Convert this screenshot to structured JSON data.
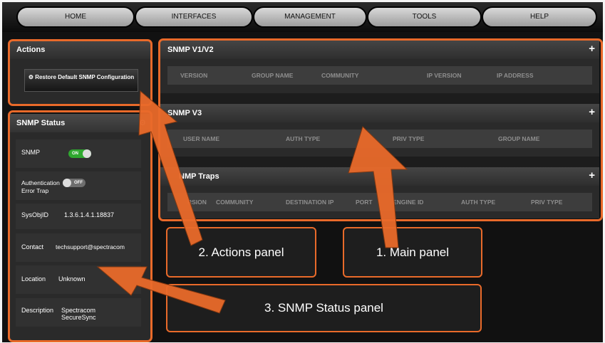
{
  "nav": [
    "HOME",
    "INTERFACES",
    "MANAGEMENT",
    "TOOLS",
    "HELP"
  ],
  "actions": {
    "title": "Actions",
    "button_icon": "gear-icon",
    "button_label": "⚙ Restore Default SNMP Configuration"
  },
  "snmp_v1v2": {
    "title": "SNMP V1/V2",
    "expand": "+",
    "columns": [
      "VERSION",
      "GROUP NAME",
      "COMMUNITY",
      "IP VERSION",
      "IP ADDRESS"
    ]
  },
  "snmp_v3": {
    "title": "SNMP V3",
    "expand": "+",
    "columns": [
      "USER NAME",
      "AUTH TYPE",
      "PRIV TYPE",
      "GROUP NAME"
    ]
  },
  "snmp_traps": {
    "title": "NMP Traps",
    "expand": "+",
    "columns": [
      "RSION",
      "COMMUNITY",
      "DESTINATION IP",
      "PORT",
      "ENGINE ID",
      "AUTH TYPE",
      "PRIV TYPE"
    ]
  },
  "status": {
    "title": "SNMP Status",
    "snmp_label": "SNMP",
    "snmp_toggle": "ON",
    "auth_label": "Authentication Error Trap",
    "auth_toggle": "OFF",
    "sysobj_label": "SysObjID",
    "sysobj_value": "1.3.6.1.4.1.18837",
    "contact_label": "Contact",
    "contact_value": "techsupport@spectracom",
    "location_label": "Location",
    "location_value": "Unknown",
    "description_label": "Description",
    "description_value": "Spectracom SecureSync"
  },
  "callouts": {
    "actions": "2. Actions panel",
    "main": "1. Main panel",
    "status": "3. SNMP Status panel"
  },
  "colors": {
    "callout": "#e96a2a",
    "toggle_on": "#2fa82f",
    "toggle_off": "#6e6e6e"
  }
}
